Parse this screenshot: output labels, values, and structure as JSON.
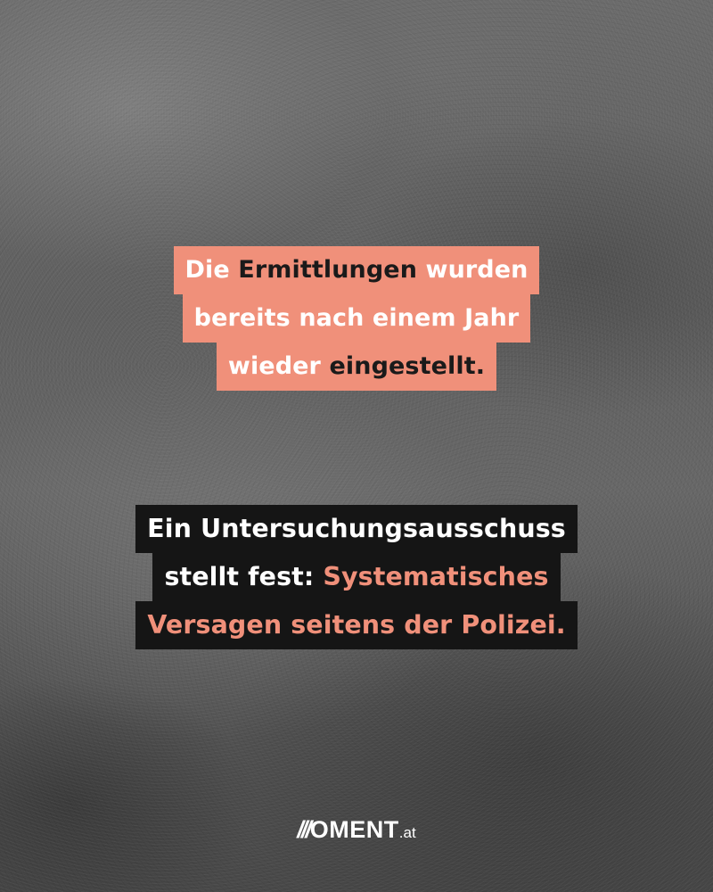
{
  "statement1": {
    "line1": {
      "a": "Die ",
      "b": "Ermittlungen",
      "c": " wurden"
    },
    "line2": "bereits nach einem Jahr",
    "line3": {
      "a": "wieder ",
      "b": "eingestellt."
    }
  },
  "statement2": {
    "line1": "Ein Untersuchungsausschuss",
    "line2": {
      "a": "stellt fest: ",
      "b": "Systematisches"
    },
    "line3": "Versagen seitens der Polizei."
  },
  "logo": {
    "slashes": "///",
    "name": "OMENT",
    "tld": ".at"
  },
  "colors": {
    "accent": "#f0907a",
    "highlight_dark": "#151515",
    "text_light": "#ffffff",
    "background": "#5a5a5a"
  }
}
